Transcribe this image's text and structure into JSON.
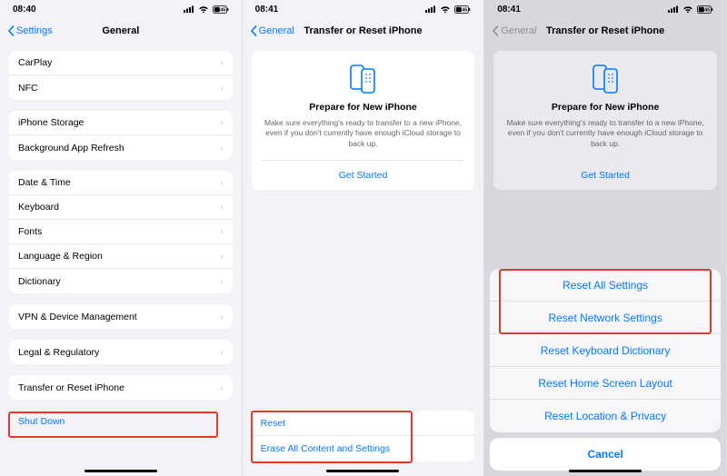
{
  "status": {
    "signal_icon": "signal",
    "wifi_icon": "wifi",
    "battery_icon": "battery-45"
  },
  "screen1": {
    "time": "08:40",
    "nav": {
      "back": "Settings",
      "title": "General"
    },
    "group1": [
      {
        "label": "CarPlay"
      },
      {
        "label": "NFC"
      }
    ],
    "group2": [
      {
        "label": "iPhone Storage"
      },
      {
        "label": "Background App Refresh"
      }
    ],
    "group3": [
      {
        "label": "Date & Time"
      },
      {
        "label": "Keyboard"
      },
      {
        "label": "Fonts"
      },
      {
        "label": "Language & Region"
      },
      {
        "label": "Dictionary"
      }
    ],
    "group4": [
      {
        "label": "VPN & Device Management"
      }
    ],
    "group5": [
      {
        "label": "Legal & Regulatory"
      }
    ],
    "group6": [
      {
        "label": "Transfer or Reset iPhone"
      }
    ],
    "shutdown": "Shut Down"
  },
  "screen2": {
    "time": "08:41",
    "nav": {
      "back": "General",
      "title": "Transfer or Reset iPhone"
    },
    "prepare": {
      "title": "Prepare for New iPhone",
      "desc": "Make sure everything's ready to transfer to a new iPhone, even if you don't currently have enough iCloud storage to back up.",
      "cta": "Get Started"
    },
    "bottom": [
      {
        "label": "Reset"
      },
      {
        "label": "Erase All Content and Settings"
      }
    ]
  },
  "screen3": {
    "time": "08:41",
    "nav": {
      "back": "General",
      "title": "Transfer or Reset iPhone"
    },
    "prepare": {
      "title": "Prepare for New iPhone",
      "desc": "Make sure everything's ready to transfer to a new iPhone, even if you don't currently have enough iCloud storage to back up.",
      "cta": "Get Started"
    },
    "sheet": {
      "options": [
        "Reset All Settings",
        "Reset Network Settings",
        "Reset Keyboard Dictionary",
        "Reset Home Screen Layout",
        "Reset Location & Privacy"
      ],
      "cancel": "Cancel"
    }
  }
}
